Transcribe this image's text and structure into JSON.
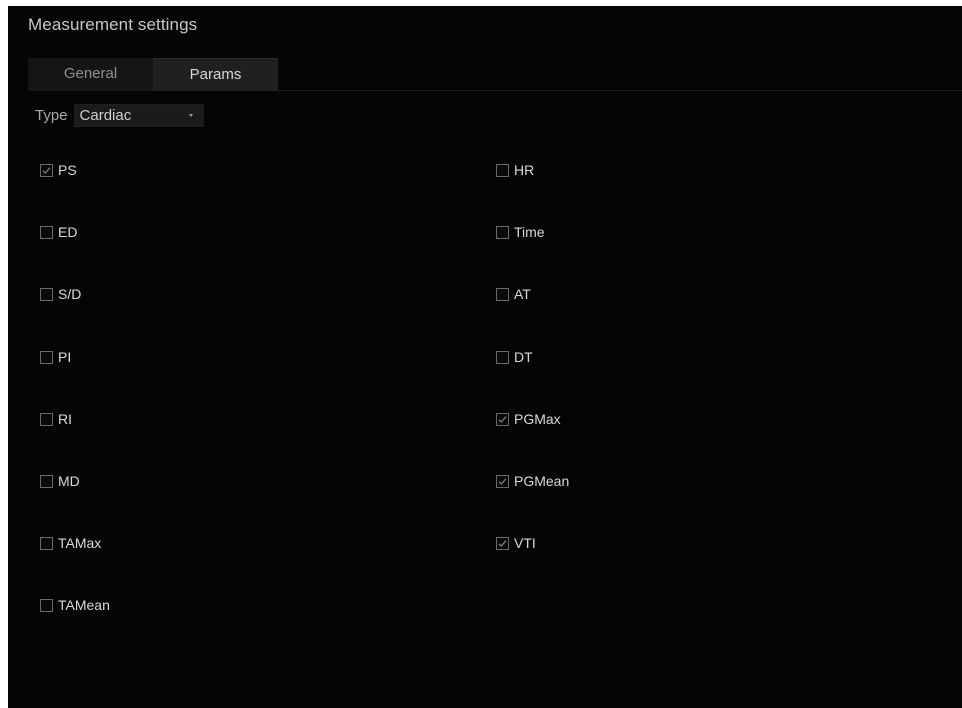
{
  "window": {
    "title": "Measurement settings"
  },
  "tabs": [
    {
      "label": "General",
      "active": false
    },
    {
      "label": "Params",
      "active": true
    }
  ],
  "type_selector": {
    "label": "Type",
    "value": "Cardiac",
    "icon": "chevron-down-icon"
  },
  "params": {
    "left": [
      {
        "label": "PS",
        "checked": true
      },
      {
        "label": "ED",
        "checked": false
      },
      {
        "label": "S/D",
        "checked": false
      },
      {
        "label": "PI",
        "checked": false
      },
      {
        "label": "RI",
        "checked": false
      },
      {
        "label": "MD",
        "checked": false
      },
      {
        "label": "TAMax",
        "checked": false
      },
      {
        "label": "TAMean",
        "checked": false
      }
    ],
    "right": [
      {
        "label": "HR",
        "checked": false
      },
      {
        "label": "Time",
        "checked": false
      },
      {
        "label": "AT",
        "checked": false
      },
      {
        "label": "DT",
        "checked": false
      },
      {
        "label": "PGMax",
        "checked": true
      },
      {
        "label": "PGMean",
        "checked": true
      },
      {
        "label": "VTI",
        "checked": true
      }
    ]
  },
  "colors": {
    "background": "#050505",
    "check_mark": "#8c8c8c",
    "check_mark_highlight": "#c08080"
  }
}
